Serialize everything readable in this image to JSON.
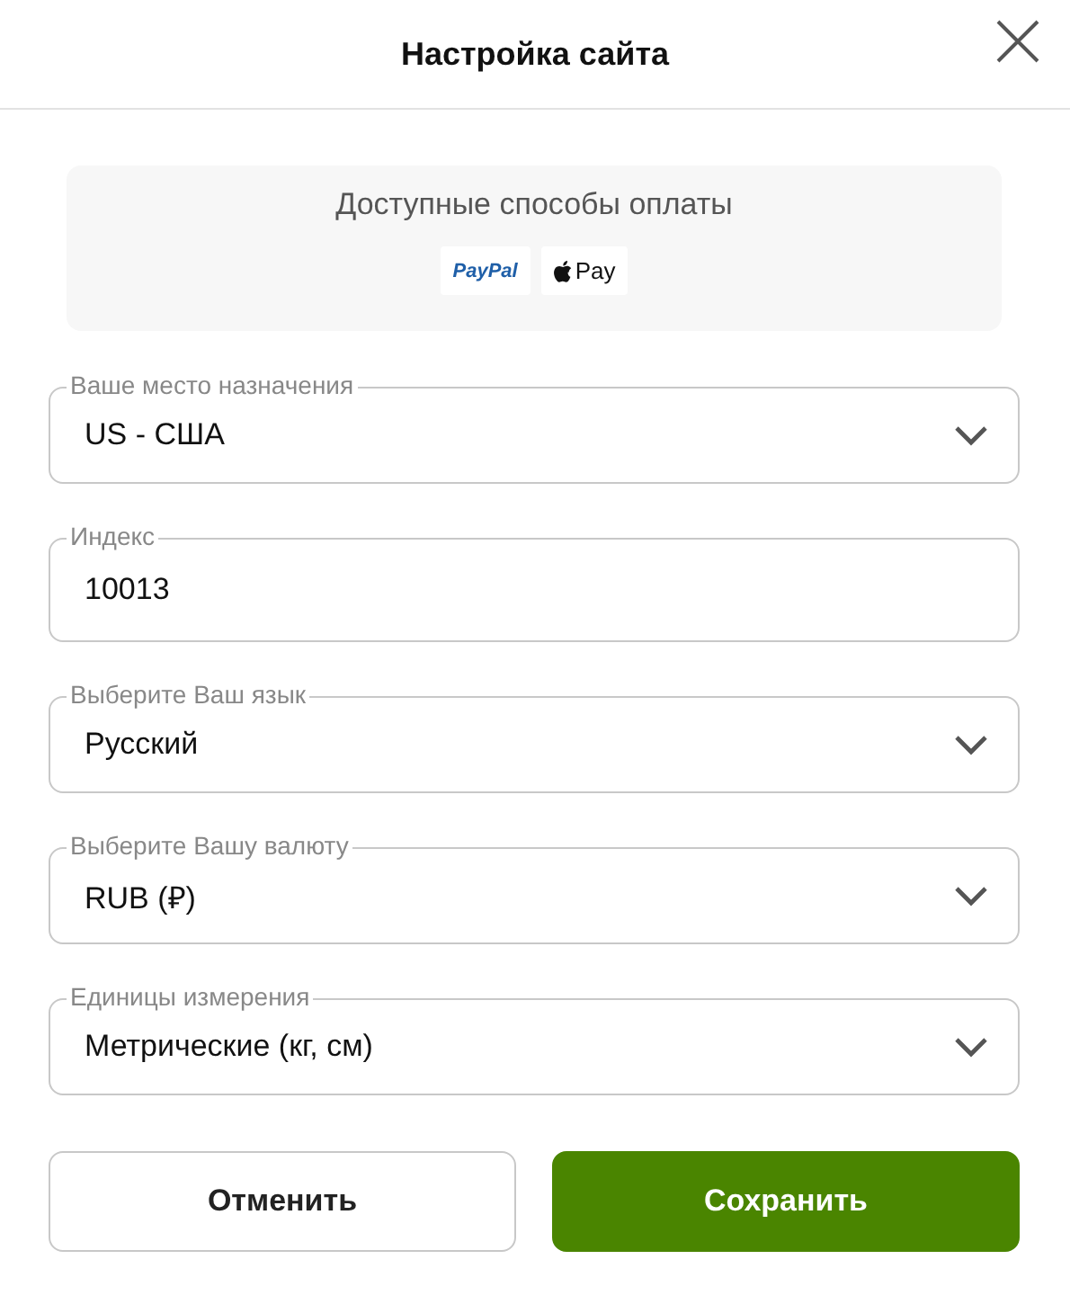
{
  "dialog": {
    "title": "Настройка сайта"
  },
  "payment": {
    "title": "Доступные способы оплаты",
    "methods": [
      {
        "kind": "paypal",
        "label": "PayPal"
      },
      {
        "kind": "applepay",
        "label": "Pay"
      }
    ]
  },
  "fields": [
    {
      "kind": "select",
      "label": "Ваше место назначения",
      "value": "US - США"
    },
    {
      "kind": "input",
      "label": "Индекс",
      "value": "10013"
    },
    {
      "kind": "select",
      "label": "Выберите Ваш язык",
      "value": "Русский"
    },
    {
      "kind": "select",
      "label": "Выберите Вашу валюту",
      "value": "RUB (₽)"
    },
    {
      "kind": "select",
      "label": "Единицы измерения",
      "value": "Метрические (кг, см)"
    }
  ],
  "buttons": [
    {
      "kind": "secondary",
      "label": "Отменить"
    },
    {
      "kind": "primary",
      "label": "Сохранить"
    }
  ]
}
